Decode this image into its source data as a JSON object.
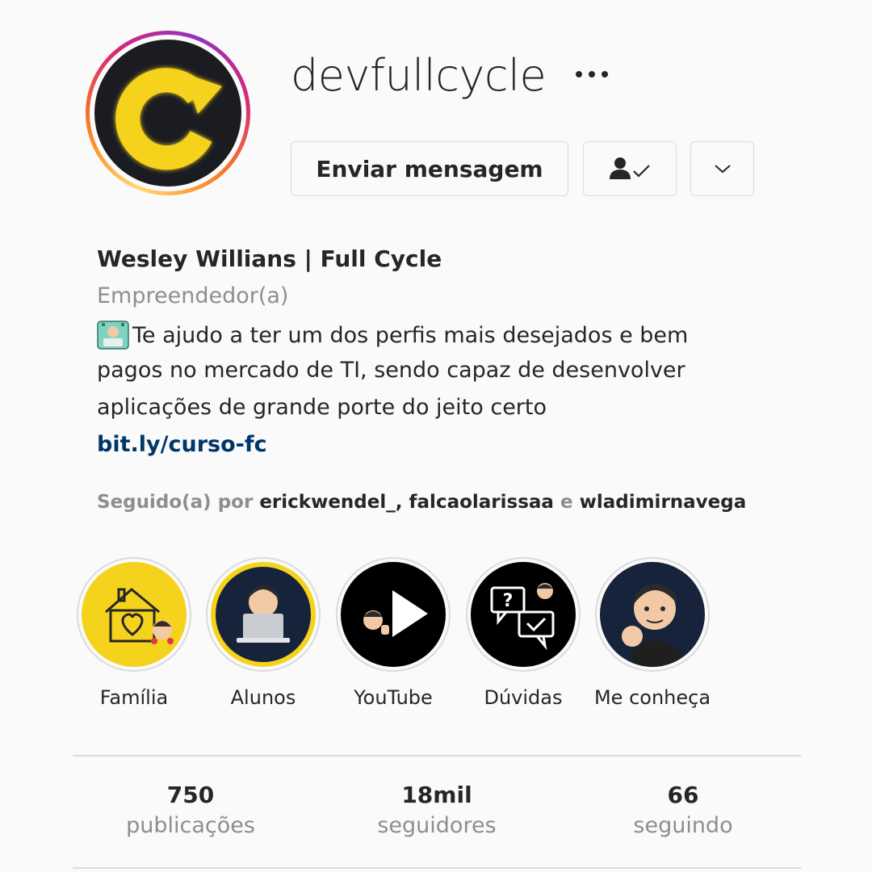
{
  "profile": {
    "username": "devfullcycle",
    "full_name": "Wesley Willians | Full Cycle",
    "category": "Empreendedor(a)",
    "bio_lines": [
      "Te ajudo a ter um dos perfis mais desejados e bem",
      "pagos no mercado de TI, sendo capaz de desenvolver",
      "aplicações de grande porte do jeito certo"
    ],
    "link": "bit.ly/curso-fc",
    "followed_by": {
      "prefix": "Seguido(a) por",
      "users": [
        "erickwendel_",
        "falcaolarissaa",
        "wladimirnavega"
      ],
      "separator_1": ",",
      "separator_2": "e"
    }
  },
  "actions": {
    "send_message_label": "Enviar mensagem",
    "following_icon": "person-check-icon",
    "suggestions_icon": "chevron-down-icon",
    "more_icon": "more-horizontal-icon"
  },
  "highlights": [
    {
      "label": "Família",
      "icon": "house-heart-icon"
    },
    {
      "label": "Alunos",
      "icon": "laptop-avatar-icon"
    },
    {
      "label": "YouTube",
      "icon": "play-icon"
    },
    {
      "label": "Dúvidas",
      "icon": "question-chat-icon"
    },
    {
      "label": "Me conheça",
      "icon": "avatar-icon"
    }
  ],
  "stats": [
    {
      "value": "750",
      "label": "publicações"
    },
    {
      "value": "18mil",
      "label": "seguidores"
    },
    {
      "value": "66",
      "label": "seguindo"
    }
  ],
  "colors": {
    "brand_yellow": "#f5d31c",
    "link_blue": "#00376b",
    "muted": "#8e8e8e",
    "border": "#dbdbdb"
  }
}
